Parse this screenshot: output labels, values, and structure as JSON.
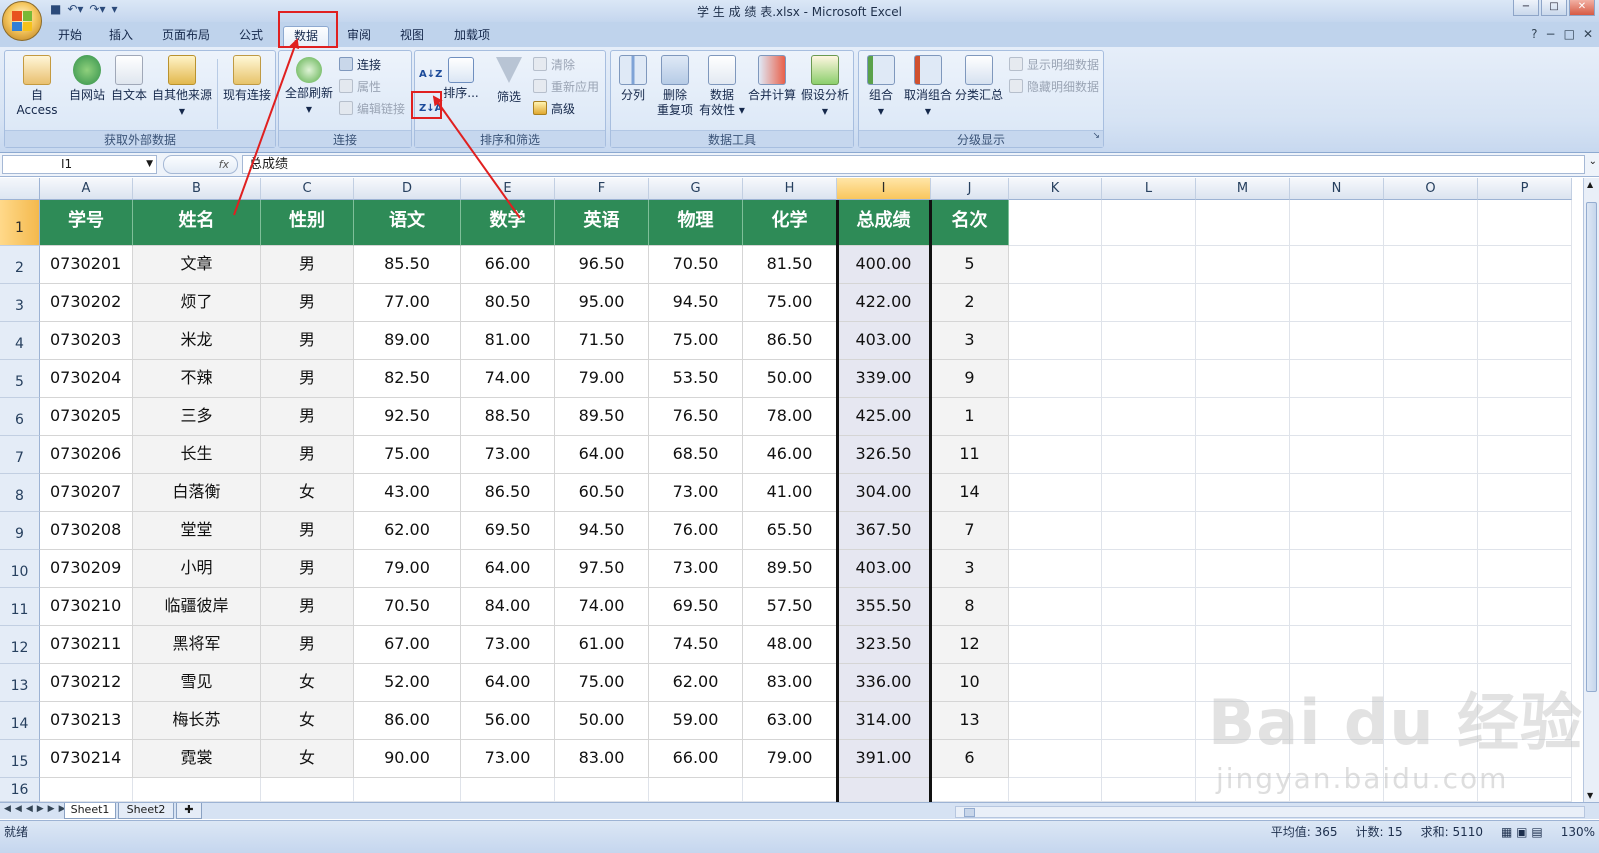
{
  "window": {
    "title": "学 生 成 绩 表.xlsx - Microsoft Excel",
    "controls": [
      "−",
      "□",
      "✕"
    ]
  },
  "ribbon_tabs": [
    {
      "label": "开始"
    },
    {
      "label": "插入"
    },
    {
      "label": "页面布局"
    },
    {
      "label": "公式"
    },
    {
      "label": "数据",
      "active": true
    },
    {
      "label": "审阅"
    },
    {
      "label": "视图"
    },
    {
      "label": "加载项"
    }
  ],
  "ribbon": {
    "get_external": {
      "label": "获取外部数据",
      "access": "自 Access",
      "web": "自网站",
      "text": "自文本",
      "other": "自其他来源",
      "existing": "现有连接"
    },
    "connections": {
      "label": "连接",
      "refresh_all": "全部刷新",
      "connections": "连接",
      "properties": "属性",
      "edit_links": "编辑链接"
    },
    "sort_filter": {
      "label": "排序和筛选",
      "sort_az": "A↓Z",
      "sort_za": "Z↓A",
      "sort": "排序...",
      "filter": "筛选",
      "clear": "清除",
      "reapply": "重新应用",
      "advanced": "高级"
    },
    "data_tools": {
      "label": "数据工具",
      "text_to_columns": "分列",
      "remove_dup_1": "删除",
      "remove_dup_2": "重复项",
      "validation_1": "数据",
      "validation_2": "有效性 ▾",
      "consolidate": "合并计算",
      "what_if": "假设分析"
    },
    "outline": {
      "label": "分级显示",
      "group": "组合",
      "ungroup": "取消组合",
      "subtotal": "分类汇总",
      "show_detail": "显示明细数据",
      "hide_detail": "隐藏明细数据"
    }
  },
  "formula_bar": {
    "name_box": "I1",
    "fx": "fx",
    "content": "总成绩"
  },
  "columns": [
    "A",
    "B",
    "C",
    "D",
    "E",
    "F",
    "G",
    "H",
    "I",
    "J",
    "K",
    "L",
    "M",
    "N",
    "O",
    "P"
  ],
  "rows": [
    "1",
    "2",
    "3",
    "4",
    "5",
    "6",
    "7",
    "8",
    "9",
    "10",
    "11",
    "12",
    "13",
    "14",
    "15",
    "16"
  ],
  "table": {
    "headers": [
      "学号",
      "姓名",
      "性别",
      "语文",
      "数学",
      "英语",
      "物理",
      "化学",
      "总成绩",
      "名次"
    ],
    "rows": [
      [
        "0730201",
        "文章",
        "男",
        "85.50",
        "66.00",
        "96.50",
        "70.50",
        "81.50",
        "400.00",
        "5"
      ],
      [
        "0730202",
        "烦了",
        "男",
        "77.00",
        "80.50",
        "95.00",
        "94.50",
        "75.00",
        "422.00",
        "2"
      ],
      [
        "0730203",
        "米龙",
        "男",
        "89.00",
        "81.00",
        "71.50",
        "75.00",
        "86.50",
        "403.00",
        "3"
      ],
      [
        "0730204",
        "不辣",
        "男",
        "82.50",
        "74.00",
        "79.00",
        "53.50",
        "50.00",
        "339.00",
        "9"
      ],
      [
        "0730205",
        "三多",
        "男",
        "92.50",
        "88.50",
        "89.50",
        "76.50",
        "78.00",
        "425.00",
        "1"
      ],
      [
        "0730206",
        "长生",
        "男",
        "75.00",
        "73.00",
        "64.00",
        "68.50",
        "46.00",
        "326.50",
        "11"
      ],
      [
        "0730207",
        "白落衡",
        "女",
        "43.00",
        "86.50",
        "60.50",
        "73.00",
        "41.00",
        "304.00",
        "14"
      ],
      [
        "0730208",
        "堂堂",
        "男",
        "62.00",
        "69.50",
        "94.50",
        "76.00",
        "65.50",
        "367.50",
        "7"
      ],
      [
        "0730209",
        "小明",
        "男",
        "79.00",
        "64.00",
        "97.50",
        "73.00",
        "89.50",
        "403.00",
        "3"
      ],
      [
        "0730210",
        "临疆彼岸",
        "男",
        "70.50",
        "84.00",
        "74.00",
        "69.50",
        "57.50",
        "355.50",
        "8"
      ],
      [
        "0730211",
        "黑将军",
        "男",
        "67.00",
        "73.00",
        "61.00",
        "74.50",
        "48.00",
        "323.50",
        "12"
      ],
      [
        "0730212",
        "雪见",
        "女",
        "52.00",
        "64.00",
        "75.00",
        "62.00",
        "83.00",
        "336.00",
        "10"
      ],
      [
        "0730213",
        "梅长苏",
        "女",
        "86.00",
        "56.00",
        "50.00",
        "59.00",
        "63.00",
        "314.00",
        "13"
      ],
      [
        "0730214",
        "霓裳",
        "女",
        "90.00",
        "73.00",
        "83.00",
        "66.00",
        "79.00",
        "391.00",
        "6"
      ]
    ]
  },
  "sheets": [
    {
      "name": "Sheet1",
      "active": true
    },
    {
      "name": "Sheet2"
    }
  ],
  "status": {
    "ready": "就绪",
    "average": "平均值: 365",
    "count": "计数: 15",
    "sum": "求和: 5110",
    "zoom": "130%"
  },
  "watermark": {
    "logo": "Bai du 经验",
    "url": "jingyan.baidu.com"
  },
  "colors": {
    "header_green": "#2e8b57",
    "annotation_red": "#e02020",
    "selected_col": "#e6e7f1"
  }
}
